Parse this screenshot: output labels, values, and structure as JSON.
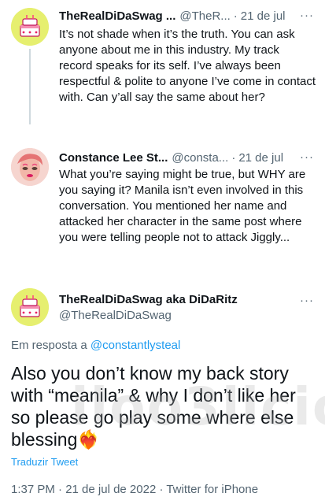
{
  "tweet1": {
    "name": "TheRealDiDaSwag ...",
    "handle": "@TheR...",
    "sep": "·",
    "date": "21 de jul",
    "more": "···",
    "text": "It’s not shade when it’s the truth. You can ask anyone about me in this industry. My track record speaks for its self. I’ve always been respectful & polite to anyone I’ve come in contact with. Can y’all say the same about her?"
  },
  "tweet2": {
    "name": "Constance Lee St...",
    "handle": "@consta...",
    "sep": "·",
    "date": "21 de jul",
    "more": "···",
    "text": "What you’re saying might be true, but WHY are you saying it? Manila isn’t even involved in this conversation. You mentioned her name and attacked her character in the same post where you were telling people not to attack Jiggly..."
  },
  "main": {
    "name": "TheRealDiDaSwag aka DiDaRitz",
    "handle": "@TheRealDiDaSwag",
    "more": "···",
    "reply_prefix": "Em resposta a",
    "reply_mention": "@constantlysteal",
    "text": "Also you don’t know my back story with “meanila” & why I don’t like her so please go play some where else blessing",
    "emoji": "❤️‍🔥",
    "translate": "Traduzir Tweet",
    "timestamp": "1:37 PM · 21 de jul de 2022 · Twitter for iPhone"
  },
  "watermark": "iloo3licious",
  "colors": {
    "accent": "#1d9bf0",
    "secondary_text": "#536471",
    "primary_text": "#0f1419",
    "avatar1_bg": "#e3ee6b",
    "avatar3_bg": "#e3ee6b",
    "avatar2_bg": "#f3c9c4"
  }
}
